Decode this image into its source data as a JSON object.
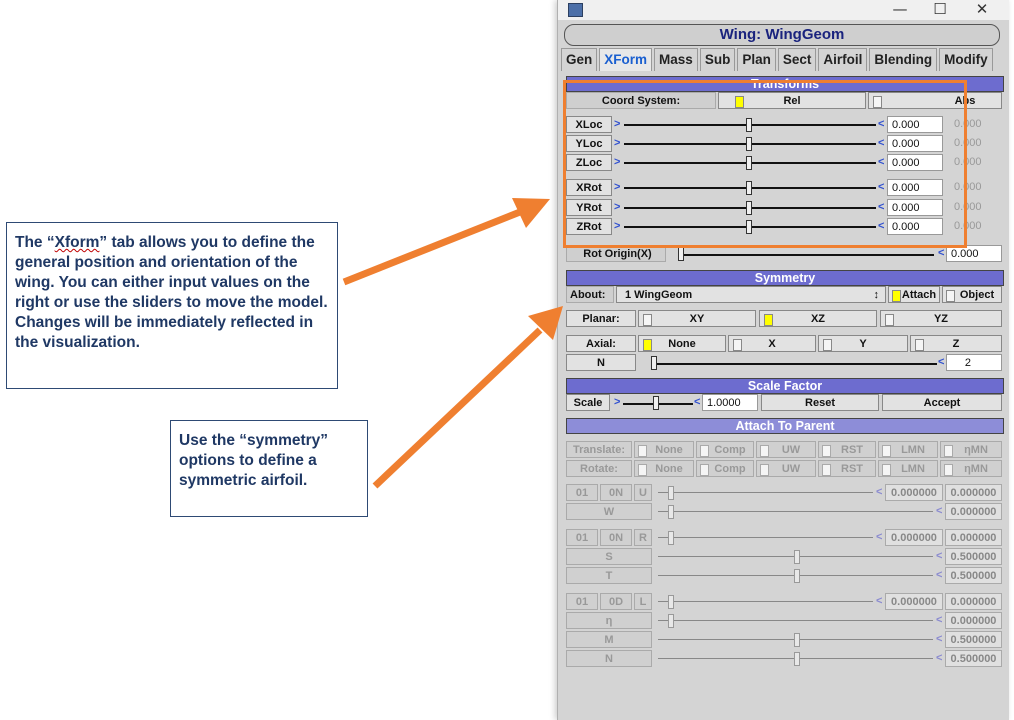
{
  "callouts": {
    "xform_prefix": "The “",
    "xform_word": "Xform",
    "xform_rest": "” tab allows you to define the general position and orientation of the wing. You can either input values on the right or use the sliders to move the model. Changes will be immediately reflected in the visualization.",
    "symmetry": "Use the “symmetry” options to define a symmetric airfoil."
  },
  "window": {
    "title": "Wing: WingGeom",
    "controls": {
      "minimize": "—",
      "maximize": "☐",
      "close": "✕"
    }
  },
  "tabs": [
    "Gen",
    "XForm",
    "Mass",
    "Sub",
    "Plan",
    "Sect",
    "Airfoil",
    "Blending",
    "Modify"
  ],
  "transforms": {
    "header": "Transforms",
    "coord_label": "Coord System:",
    "rel": "Rel",
    "abs": "Abs",
    "rows": [
      {
        "label": "XLoc",
        "value": "0.000",
        "ghost": "0.000"
      },
      {
        "label": "YLoc",
        "value": "0.000",
        "ghost": "0.000"
      },
      {
        "label": "ZLoc",
        "value": "0.000",
        "ghost": "0.000"
      },
      {
        "label": "XRot",
        "value": "0.000",
        "ghost": "0.000"
      },
      {
        "label": "YRot",
        "value": "0.000",
        "ghost": "0.000"
      },
      {
        "label": "ZRot",
        "value": "0.000",
        "ghost": "0.000"
      }
    ],
    "rot_origin_label": "Rot Origin(X)",
    "rot_origin_value": "0.000"
  },
  "symmetry": {
    "header": "Symmetry",
    "about_label": "About:",
    "about_value": "1 WingGeom",
    "attach": "Attach",
    "object": "Object",
    "planar_label": "Planar:",
    "planar": [
      "XY",
      "XZ",
      "YZ"
    ],
    "axial_label": "Axial:",
    "axial": [
      "None",
      "X",
      "Y",
      "Z"
    ],
    "n_label": "N",
    "n_value": "2"
  },
  "scale": {
    "header": "Scale Factor",
    "label": "Scale",
    "value": "1.0000",
    "reset": "Reset",
    "accept": "Accept"
  },
  "attach": {
    "header": "Attach To Parent",
    "translate_label": "Translate:",
    "rotate_label": "Rotate:",
    "options": [
      "None",
      "Comp",
      "UW",
      "RST",
      "LMN",
      "ηMN"
    ],
    "u_group": {
      "c1": "01",
      "c2": "0N",
      "rows": [
        {
          "label": "U",
          "value": "0.000000",
          "ghost": "0.000000"
        },
        {
          "label": "W",
          "value": "0.000000"
        }
      ]
    },
    "r_group": {
      "c1": "01",
      "c2": "0N",
      "rows": [
        {
          "label": "R",
          "value": "0.000000",
          "ghost": "0.000000"
        },
        {
          "label": "S",
          "value": "0.500000"
        },
        {
          "label": "T",
          "value": "0.500000"
        }
      ]
    },
    "l_group": {
      "c1": "01",
      "c2": "0D",
      "rows": [
        {
          "label": "L",
          "value": "0.000000",
          "ghost": "0.000000"
        },
        {
          "label": "η",
          "value": "0.000000"
        },
        {
          "label": "M",
          "value": "0.500000"
        },
        {
          "label": "N",
          "value": "0.500000"
        }
      ]
    }
  }
}
